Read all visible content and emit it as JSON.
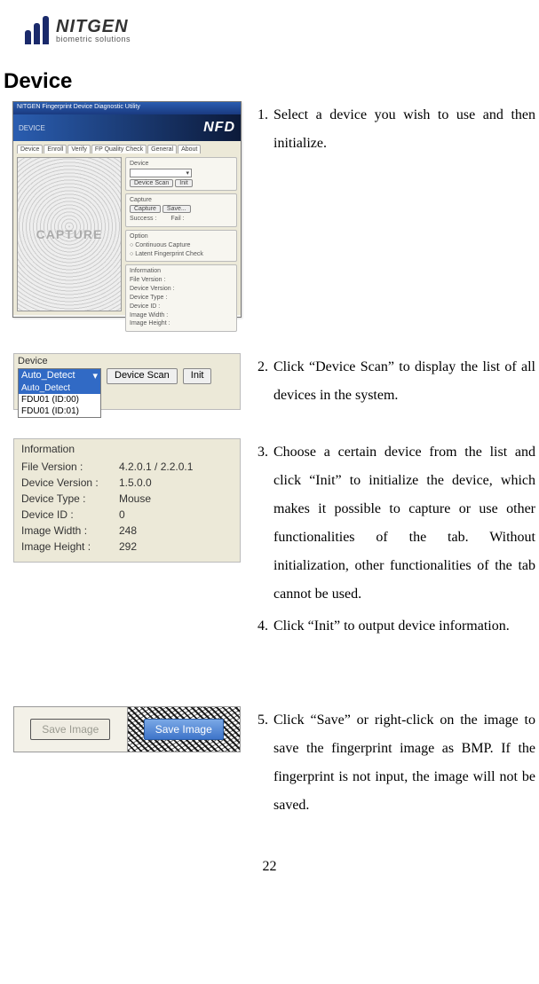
{
  "logo": {
    "name": "NITGEN",
    "sub": "biometric solutions"
  },
  "sectionTitle": "Device",
  "steps": {
    "s1": {
      "num": "1.",
      "text": "Select a device you wish to use and then initialize."
    },
    "s2": {
      "num": "2.",
      "text": "Click “Device Scan” to display the list of all devices in the system."
    },
    "s3": {
      "num": "3.",
      "text": "Choose a certain device from the list and click “Init” to initialize the device, which makes it possible to capture or use other functionalities of the tab. Without initialization, other functionalities of the tab cannot be used."
    },
    "s4": {
      "num": "4.",
      "text": "Click “Init” to output device information."
    },
    "s5": {
      "num": "5.",
      "text": "Click “Save” or right-click on the image to save the fingerprint image as BMP. If the fingerprint is not input, the image will not be saved."
    }
  },
  "appWindow": {
    "title": "NITGEN Fingerprint Device Diagnostic Utility",
    "bannerLeft": "DEVICE",
    "bannerRight": "NFD",
    "tabs": [
      "Device",
      "Enroll",
      "Verify",
      "FP Quality Check",
      "General",
      "About"
    ],
    "captureLabel": "CAPTURE",
    "groups": {
      "device": {
        "label": "Device",
        "scan": "Device Scan",
        "init": "Init"
      },
      "capture": {
        "label": "Capture",
        "btnCapture": "Capture",
        "btnSave": "Save...",
        "success": "Success :",
        "fail": "Fail :"
      },
      "option": {
        "label": "Option",
        "opt1": "Continuous Capture",
        "opt2": "Latent Fingerprint Check"
      },
      "information": {
        "label": "Information",
        "items": [
          "File Version :",
          "Device Version :",
          "Device Type :",
          "Device ID :",
          "Image Width :",
          "Image Height :"
        ]
      }
    }
  },
  "deviceDropdown": {
    "label": "Device",
    "selected": "Auto_Detect",
    "options": [
      "Auto_Detect",
      "FDU01 (ID:00)",
      "FDU01 (ID:01)"
    ],
    "scanBtn": "Device Scan",
    "initBtn": "Init"
  },
  "infoPanel": {
    "title": "Information",
    "rows": [
      {
        "k": "File Version :",
        "v": "4.2.0.1 / 2.2.0.1"
      },
      {
        "k": "Device Version :",
        "v": "1.5.0.0"
      },
      {
        "k": "Device Type :",
        "v": "Mouse"
      },
      {
        "k": "Device ID :",
        "v": "0"
      },
      {
        "k": "Image Width :",
        "v": "248"
      },
      {
        "k": "Image Height :",
        "v": "292"
      }
    ]
  },
  "saveButtons": {
    "disabled": "Save Image",
    "primary": "Save Image"
  },
  "pageNumber": "22"
}
